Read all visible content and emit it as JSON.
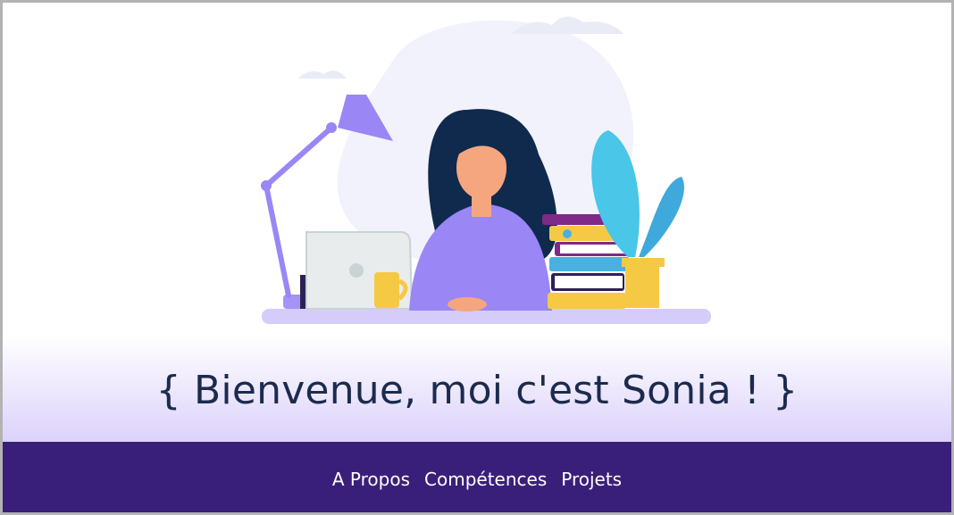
{
  "hero": {
    "title": "{ Bienvenue, moi c'est Sonia ! }"
  },
  "nav": {
    "items": [
      {
        "label": "A Propos"
      },
      {
        "label": "Compétences"
      },
      {
        "label": "Projets"
      }
    ]
  },
  "colors": {
    "nav_background": "#3a1f7a",
    "title_text": "#1c2b4d",
    "accent_purple": "#9b86f5",
    "gradient_end": "#dcd2fb"
  }
}
